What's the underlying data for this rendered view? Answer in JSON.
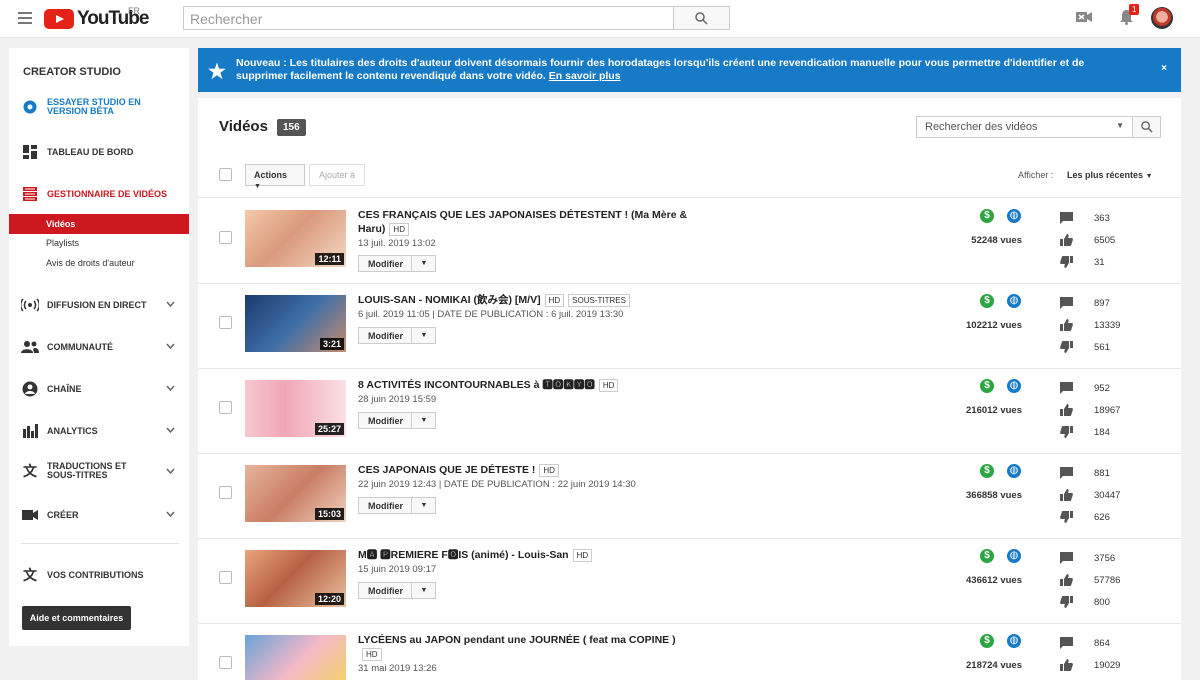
{
  "header": {
    "logo_text": "YouTube",
    "country": "FR",
    "search_placeholder": "Rechercher",
    "notif_count": "1"
  },
  "sidebar": {
    "title": "CREATOR STUDIO",
    "beta": "ESSAYER STUDIO EN VERSION BÊTA",
    "dashboard": "TABLEAU DE BORD",
    "video_manager": "GESTIONNAIRE DE VIDÉOS",
    "sub": [
      "Vidéos",
      "Playlists",
      "Avis de droits d'auteur"
    ],
    "sections": [
      "DIFFUSION EN DIRECT",
      "COMMUNAUTÉ",
      "CHAÎNE",
      "ANALYTICS",
      "TRADUCTIONS ET SOUS-TITRES",
      "CRÉER"
    ],
    "contributions": "VOS CONTRIBUTIONS",
    "help": "Aide et commentaires"
  },
  "banner": {
    "text": "Nouveau : Les titulaires des droits d'auteur doivent désormais fournir des horodatages lorsqu'ils créent une revendication manuelle pour vous permettre d'identifier et de supprimer facilement le contenu revendiqué dans votre vidéo.",
    "link": "En savoir plus",
    "close": "×"
  },
  "main": {
    "title": "Vidéos",
    "count": "156",
    "search_placeholder": "Rechercher des vidéos",
    "actions": "Actions",
    "add_to": "Ajouter à",
    "show_label": "Afficher :",
    "sort": "Les plus récentes",
    "modify": "Modifier",
    "videos": [
      {
        "title": "CES FRANÇAIS QUE LES JAPONAISES DÉTESTENT ! (Ma Mère & Haru)",
        "tags": [
          "HD"
        ],
        "date": "13 juil. 2019 13:02",
        "duration": "12:11",
        "views": "52248 vues",
        "comments": "363",
        "likes": "6505",
        "dislikes": "31"
      },
      {
        "title": "LOUIS-SAN - NOMIKAI (飲み会) [M/V]",
        "tags": [
          "HD",
          "SOUS-TITRES"
        ],
        "date": "6 juil. 2019 11:05 | DATE DE PUBLICATION : 6 juil. 2019 13:30",
        "duration": "3:21",
        "views": "102212 vues",
        "comments": "897",
        "likes": "13339",
        "dislikes": "561"
      },
      {
        "title": "8 ACTIVITÉS INCONTOURNABLES à 🆃🅾🅺🆈🅾",
        "tags": [
          "HD"
        ],
        "date": "28 juin 2019 15:59",
        "duration": "25:27",
        "views": "216012 vues",
        "comments": "952",
        "likes": "18967",
        "dislikes": "184"
      },
      {
        "title": "CES JAPONAIS QUE JE DÉTESTE !",
        "tags": [
          "HD"
        ],
        "date": "22 juin 2019 12:43 | DATE DE PUBLICATION : 22 juin 2019 14:30",
        "duration": "15:03",
        "views": "366858 vues",
        "comments": "881",
        "likes": "30447",
        "dislikes": "626"
      },
      {
        "title": "M🅰 🅿REMIERE F🅾IS (animé) - Louis-San",
        "tags": [
          "HD"
        ],
        "date": "15 juin 2019 09:17",
        "duration": "12:20",
        "views": "436612 vues",
        "comments": "3756",
        "likes": "57786",
        "dislikes": "800"
      },
      {
        "title": "LYCÉENS au JAPON pendant une JOURNÉE ( feat ma COPINE )",
        "tags": [
          "HD"
        ],
        "date": "31 mai 2019 13:26",
        "duration": "",
        "views": "218724 vues",
        "comments": "864",
        "likes": "19029",
        "dislikes": ""
      }
    ]
  }
}
